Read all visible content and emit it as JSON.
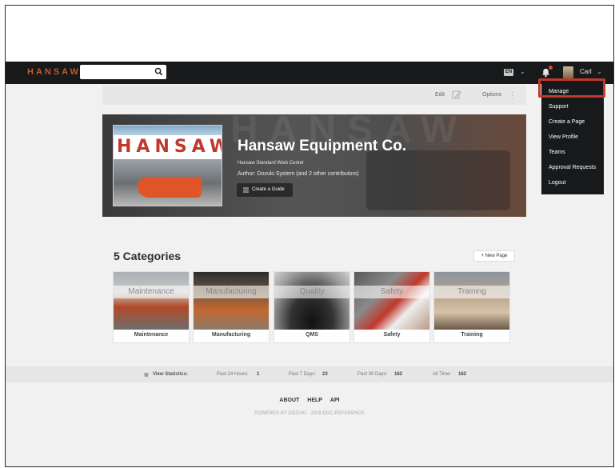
{
  "nav": {
    "logo": "HANSAW",
    "search_placeholder": "",
    "language": "EN",
    "user": "Carl"
  },
  "toolbar": {
    "edit_label": "Edit",
    "options_label": "Options"
  },
  "hero": {
    "image_brand": "HANSAW",
    "title": "Hansaw Equipment Co.",
    "subtitle": "Hansaw Standard Work Center",
    "author": "Author: Dozuki System (and 2 other contributors)",
    "create_guide_label": "Create a Guide"
  },
  "categories": {
    "heading": "5 Categories",
    "new_page_label": "+ New Page",
    "items": [
      {
        "band": "Maintenance",
        "label": "Maintenance"
      },
      {
        "band": "Manufacturing",
        "label": "Manufacturing"
      },
      {
        "band": "Quality",
        "label": "QMS"
      },
      {
        "band": "Safety",
        "label": "Safety"
      },
      {
        "band": "Training",
        "label": "Training"
      }
    ]
  },
  "stats": {
    "label": "View Statistics:",
    "past24": "Past 24 Hours:",
    "past24_value": "1",
    "past7": "Past 7 Days:",
    "past7_value": "23",
    "past30": "Past 30 Days:",
    "past30_value": "162",
    "alltime": "All Time:",
    "alltime_value": "162"
  },
  "footer": {
    "links": [
      "ABOUT",
      "HELP",
      "API"
    ],
    "powered": "POWERED BY DOZUKI - 2019 DOC-REFERENCE"
  },
  "menu": {
    "items": [
      "Manage",
      "Support",
      "Create a Page",
      "View Profile",
      "Teams",
      "Approval Requests",
      "Logout"
    ]
  },
  "colors": {
    "nav_bg": "#17191b",
    "brand": "#c45a2c",
    "highlight": "#c0392b",
    "page_bg": "#f1f1f1"
  },
  "icons": [
    "search-icon",
    "bell-icon",
    "edit-icon",
    "options-icon",
    "guide-list-icon",
    "chevron-down-icon",
    "stats-icon"
  ]
}
